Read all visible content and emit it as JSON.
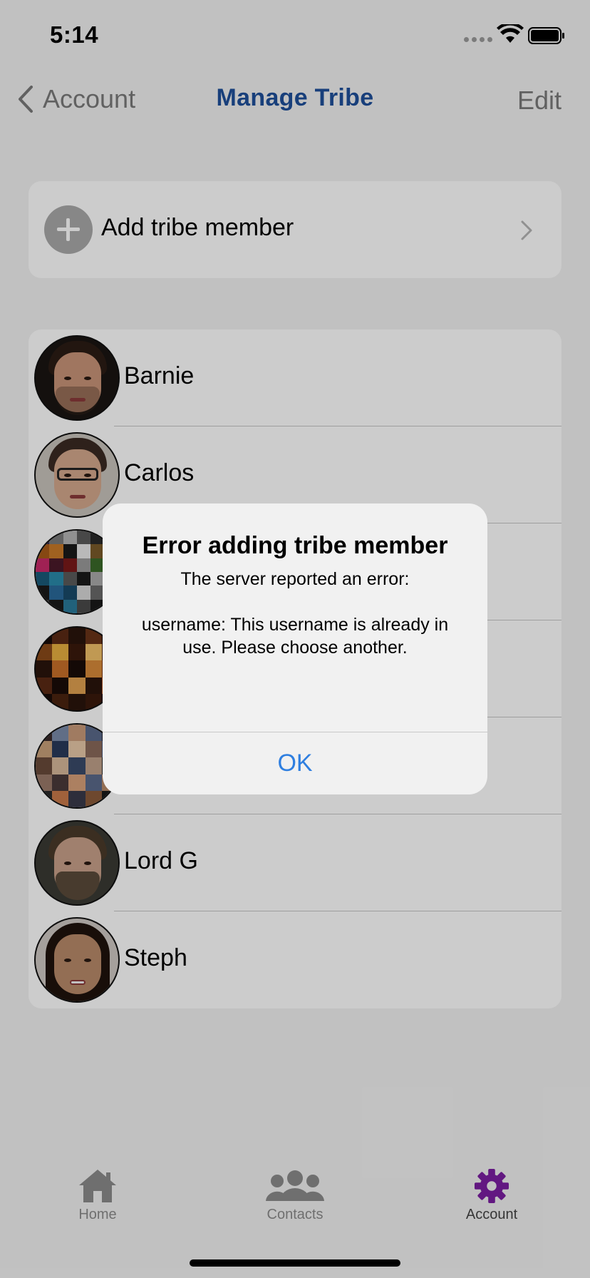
{
  "status_bar": {
    "time": "5:14"
  },
  "nav": {
    "back_label": "Account",
    "title": "Manage Tribe",
    "edit_label": "Edit"
  },
  "add_member": {
    "label": "Add tribe member"
  },
  "members": [
    {
      "name": "Barnie"
    },
    {
      "name": "Carlos"
    },
    {
      "name": ""
    },
    {
      "name": ""
    },
    {
      "name": ""
    },
    {
      "name": "Lord G"
    },
    {
      "name": "Steph"
    }
  ],
  "alert": {
    "title": "Error adding tribe member",
    "message": "The server reported an error:\n\nusername: This username is already in use. Please choose another.",
    "ok_label": "OK"
  },
  "tabs": [
    {
      "label": "Home",
      "icon": "home-icon"
    },
    {
      "label": "Contacts",
      "icon": "contacts-icon"
    },
    {
      "label": "Account",
      "icon": "gear-icon"
    }
  ],
  "colors": {
    "title_blue": "#1f4f9a",
    "accent_purple": "#7b1fa2",
    "link_blue": "#2f7fe0",
    "muted_gray": "#8b8b8b"
  }
}
